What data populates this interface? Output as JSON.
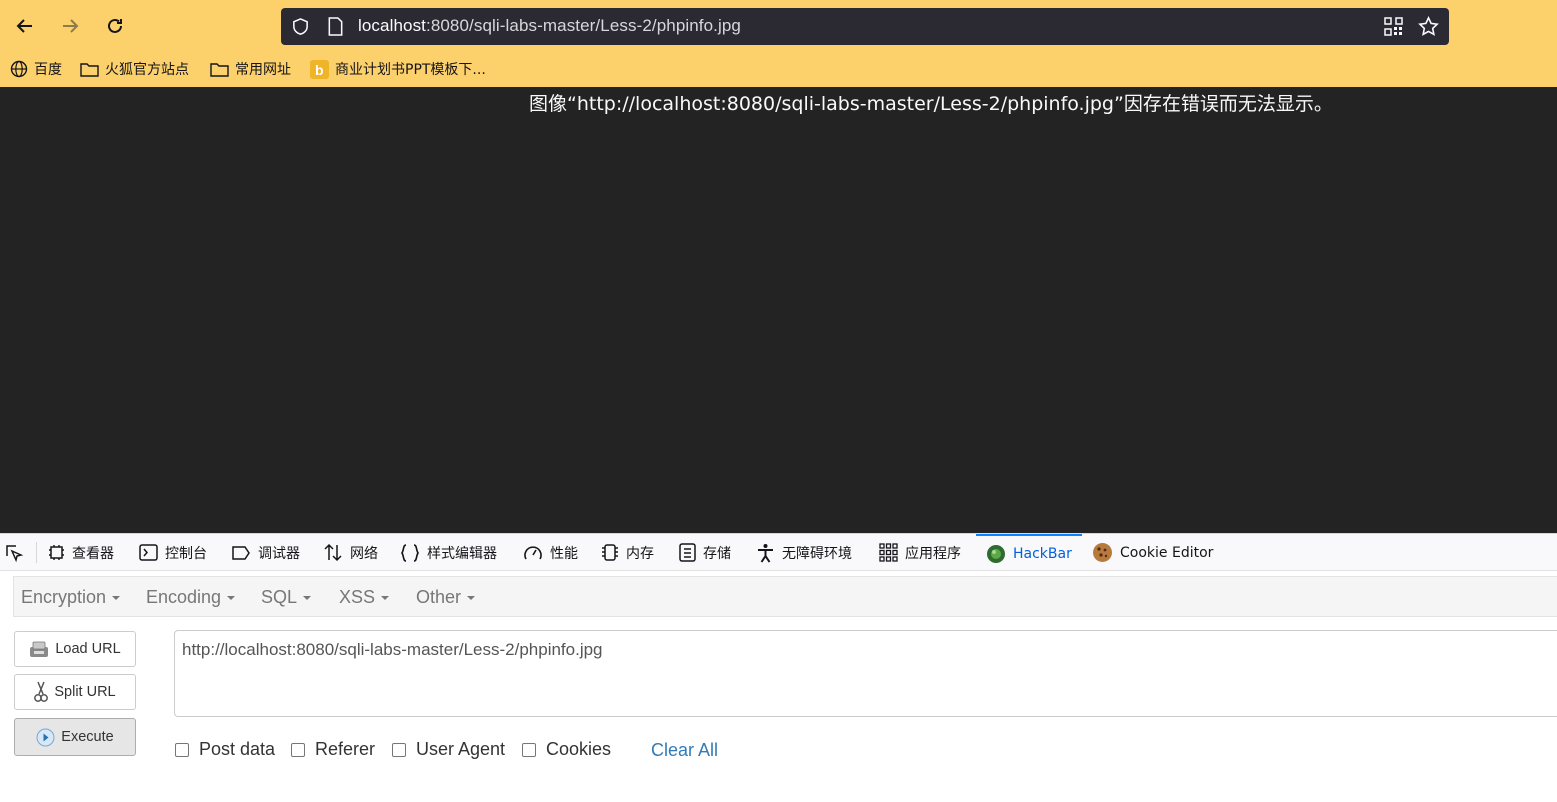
{
  "browser": {
    "url_host": "localhost",
    "url_path": ":8080/sqli-labs-master/Less-2/phpinfo.jpg"
  },
  "bookmarks": [
    {
      "label": "百度",
      "icon": "globe-icon"
    },
    {
      "label": "火狐官方站点",
      "icon": "folder-icon"
    },
    {
      "label": "常用网址",
      "icon": "folder-icon"
    },
    {
      "label": "商业计划书PPT模板下...",
      "icon": "bookmark-favicon"
    }
  ],
  "page": {
    "error_message": "图像“http://localhost:8080/sqli-labs-master/Less-2/phpinfo.jpg”因存在错误而无法显示。"
  },
  "devtools": {
    "tabs": [
      {
        "label": "查看器",
        "icon": "inspector-icon"
      },
      {
        "label": "控制台",
        "icon": "console-icon"
      },
      {
        "label": "调试器",
        "icon": "debugger-icon"
      },
      {
        "label": "网络",
        "icon": "network-icon"
      },
      {
        "label": "样式编辑器",
        "icon": "style-editor-icon"
      },
      {
        "label": "性能",
        "icon": "performance-icon"
      },
      {
        "label": "内存",
        "icon": "memory-icon"
      },
      {
        "label": "存储",
        "icon": "storage-icon"
      },
      {
        "label": "无障碍环境",
        "icon": "accessibility-icon"
      },
      {
        "label": "应用程序",
        "icon": "application-icon"
      },
      {
        "label": "HackBar",
        "icon": "hackbar-icon",
        "active": true
      },
      {
        "label": "Cookie Editor",
        "icon": "cookie-icon"
      }
    ],
    "active_color": "#0060df"
  },
  "hackbar": {
    "menus": [
      "Encryption",
      "Encoding",
      "SQL",
      "XSS",
      "Other"
    ],
    "buttons": {
      "load": "Load URL",
      "split": "Split URL",
      "execute": "Execute"
    },
    "url_value": "http://localhost:8080/sqli-labs-master/Less-2/phpinfo.jpg",
    "checkboxes": [
      "Post data",
      "Referer",
      "User Agent",
      "Cookies"
    ],
    "clear_all": "Clear All"
  }
}
